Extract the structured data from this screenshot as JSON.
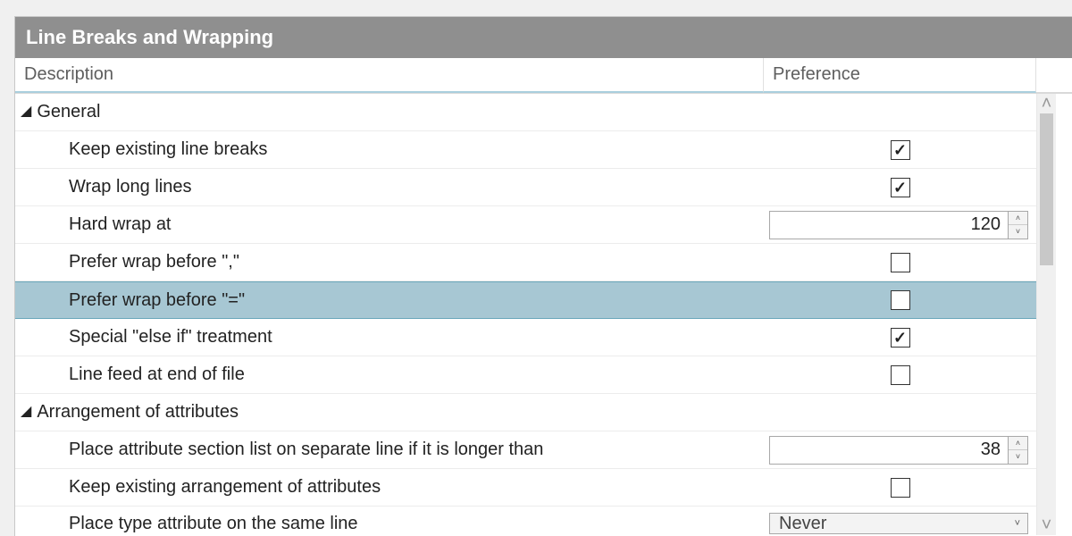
{
  "panel": {
    "title": "Line Breaks and Wrapping",
    "columns": {
      "description": "Description",
      "preference": "Preference"
    }
  },
  "groups": [
    {
      "name": "General",
      "items": [
        {
          "label": "Keep existing line breaks",
          "type": "check",
          "checked": true
        },
        {
          "label": "Wrap long lines",
          "type": "check",
          "checked": true
        },
        {
          "label": "Hard wrap at",
          "type": "number",
          "value": "120"
        },
        {
          "label": "Prefer wrap before \",\"",
          "type": "check",
          "checked": false
        },
        {
          "label": "Prefer wrap before \"=\"",
          "type": "check",
          "checked": false,
          "selected": true
        },
        {
          "label": "Special \"else if\" treatment",
          "type": "check",
          "checked": true
        },
        {
          "label": "Line feed at end of file",
          "type": "check",
          "checked": false
        }
      ]
    },
    {
      "name": "Arrangement of attributes",
      "items": [
        {
          "label": "Place attribute section list on separate line if it is longer than",
          "type": "number",
          "value": "38"
        },
        {
          "label": "Keep existing arrangement of attributes",
          "type": "check",
          "checked": false
        },
        {
          "label": "Place type attribute on the same line",
          "type": "select",
          "value": "Never"
        }
      ]
    }
  ],
  "glyphs": {
    "triangle": "◢",
    "check": "✓",
    "chev_up": "˄",
    "chev_down": "˅",
    "arrow_up_s": "▲",
    "arrow_down_s": "▼"
  }
}
